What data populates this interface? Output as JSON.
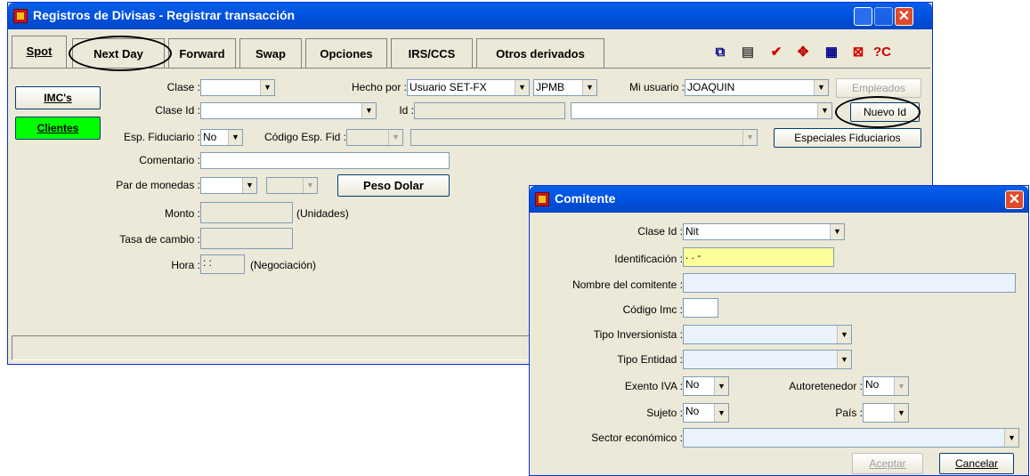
{
  "main_window": {
    "title": "Registros de Divisas - Registrar transacción",
    "tabs": [
      "Spot",
      "Next Day",
      "Forward",
      "Swap",
      "Opciones",
      "IRS/CCS",
      "Otros derivados"
    ],
    "left_buttons": {
      "imcs": "IMC's",
      "clientes": "Clientes"
    },
    "form": {
      "clase_label": "Clase :",
      "hecho_por_label": "Hecho por :",
      "hecho_por_value": "Usuario SET-FX",
      "hecho_por_second": "JPMB",
      "mi_usuario_label": "Mi usuario :",
      "mi_usuario_value": "JOAQUIN",
      "empleados_button": "Empleados",
      "clase_id_label": "Clase Id :",
      "id_label": "Id :",
      "nuevo_id_button": "Nuevo Id",
      "esp_fiduciario_label": "Esp. Fiduciario :",
      "esp_fiduciario_value": "No",
      "codigo_esp_fid_label": "Código Esp. Fid :",
      "especiales_button": "Especiales Fiduciarios",
      "comentario_label": "Comentario :",
      "par_monedas_label": "Par de monedas :",
      "peso_dolar_button": "Peso Dolar",
      "monto_label": "Monto :",
      "unidades_text": "(Unidades)",
      "tasa_label": "Tasa de cambio :",
      "hora_label": "Hora :",
      "hora_value": " : :",
      "negociacion_text": "(Negociación)"
    }
  },
  "dialog": {
    "title": "Comitente",
    "clase_id_label": "Clase Id :",
    "clase_id_value": "Nit",
    "identificacion_label": "Identificación :",
    "identificacion_value": " .  .  -",
    "nombre_label": "Nombre del comitente :",
    "codigo_imc_label": "Código Imc :",
    "tipo_inversionista_label": "Tipo Inversionista :",
    "tipo_entidad_label": "Tipo Entidad :",
    "exento_iva_label": "Exento IVA :",
    "exento_iva_value": "No",
    "autoretenedor_label": "Autoretenedor :",
    "autoretenedor_value": "No",
    "sujeto_label": "Sujeto :",
    "sujeto_value": "No",
    "pais_label": "País :",
    "sector_label": "Sector económico :",
    "aceptar_button": "Aceptar",
    "cancelar_button": "Cancelar"
  },
  "colors": {
    "title_blue": "#0054e3",
    "clientes_green": "#00ff00",
    "highlight_yellow": "#ffff99"
  }
}
